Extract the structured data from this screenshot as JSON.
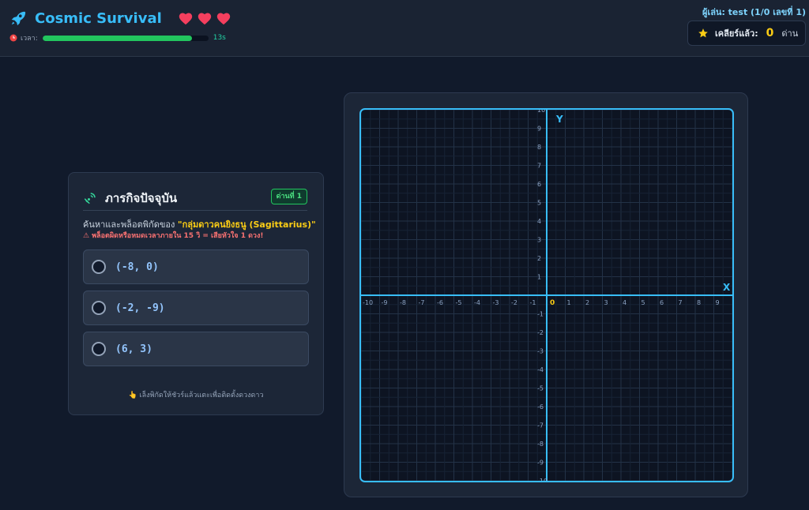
{
  "header": {
    "title": "Cosmic Survival",
    "hearts": 3,
    "timer_label": "เวลา:",
    "timer_value": "13s",
    "timer_fraction": 0.9,
    "player_info": "ผู้เล่น: test (1/0 เลขที่ 1)",
    "cleared_label": "เคลียร์แล้ว:",
    "cleared_count": "0",
    "cleared_unit": "ด่าน"
  },
  "mission": {
    "title": "ภารกิจปัจจุบัน",
    "level_badge": "ด่านที่ 1",
    "instruction_prefix": "ค้นหาและพล็อตพิกัดของ",
    "target": "\"กลุ่มดาวคนยิงธนู (Sagittarius)\"",
    "warning": "⚠ พล็อตผิดหรือหมดเวลาภายใน 15 วิ = เสียหัวใจ 1 ดวง!",
    "options": [
      "(-8, 0)",
      "(-2, -9)",
      "(6, 3)"
    ],
    "hint": "👆 เล็งพิกัดให้ชัวร์แล้วแตะเพื่อติดตั้งดวงดาว"
  },
  "graph": {
    "x_label": "X",
    "y_label": "Y",
    "origin_label": "0",
    "x_ticks": [
      "-10",
      "-9",
      "-8",
      "-7",
      "-6",
      "-5",
      "-4",
      "-3",
      "-2",
      "-1",
      "1",
      "2",
      "3",
      "4",
      "5",
      "6",
      "7",
      "8",
      "9",
      "10"
    ],
    "y_ticks": [
      "10",
      "9",
      "8",
      "7",
      "6",
      "5",
      "4",
      "3",
      "2",
      "1",
      "-1",
      "-2",
      "-3",
      "-4",
      "-5",
      "-6",
      "-7",
      "-8",
      "-9",
      "-10"
    ],
    "range": [
      -10,
      10
    ],
    "grid": true,
    "colors": {
      "axis": "#38bdf8",
      "grid": "#1e2b3e",
      "frame": "#38bdf8"
    }
  }
}
